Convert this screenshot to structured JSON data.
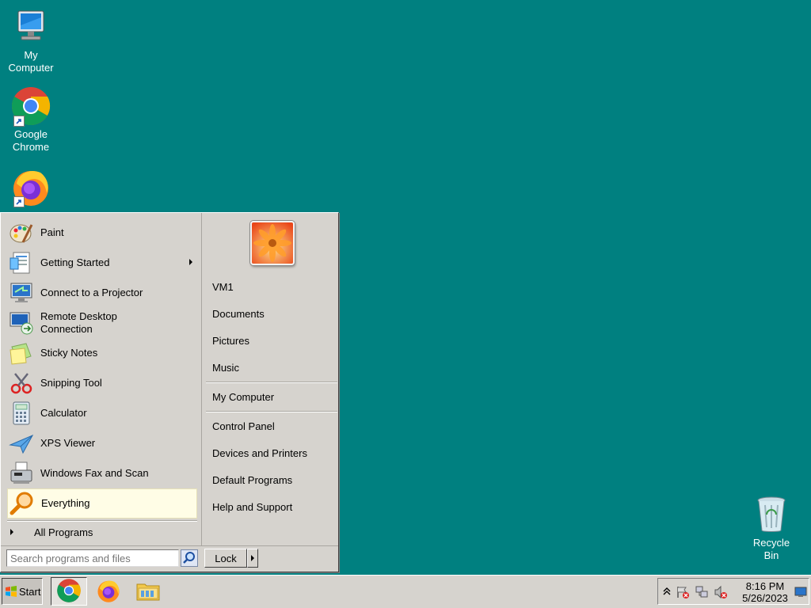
{
  "desktop": {
    "icons": [
      {
        "label": "My Computer",
        "icon": "computer-icon"
      },
      {
        "label": "Google Chrome",
        "icon": "chrome-icon"
      },
      {
        "label": "Firefox",
        "icon": "firefox-icon"
      },
      {
        "label": "Recycle Bin",
        "icon": "recycle-bin-icon"
      }
    ]
  },
  "start_menu": {
    "programs": [
      {
        "label": "Paint",
        "icon": "paint-icon"
      },
      {
        "label": "Getting Started",
        "icon": "getting-started-icon",
        "has_submenu": true
      },
      {
        "label": "Connect to a Projector",
        "icon": "projector-icon"
      },
      {
        "label": "Remote Desktop Connection",
        "icon": "remote-desktop-icon"
      },
      {
        "label": "Sticky Notes",
        "icon": "sticky-notes-icon"
      },
      {
        "label": "Snipping Tool",
        "icon": "snipping-tool-icon"
      },
      {
        "label": "Calculator",
        "icon": "calculator-icon"
      },
      {
        "label": "XPS Viewer",
        "icon": "xps-viewer-icon"
      },
      {
        "label": "Windows Fax and Scan",
        "icon": "fax-scan-icon"
      },
      {
        "label": "Everything",
        "icon": "everything-search-icon",
        "highlighted": true
      }
    ],
    "all_programs": "All Programs",
    "right_items": {
      "user": "VM1",
      "documents": "Documents",
      "pictures": "Pictures",
      "music": "Music",
      "my_computer": "My Computer",
      "control_panel": "Control Panel",
      "devices_printers": "Devices and Printers",
      "default_programs": "Default Programs",
      "help_support": "Help and Support"
    },
    "search_placeholder": "Search programs and files",
    "lock_label": "Lock"
  },
  "taskbar": {
    "start_label": "Start",
    "pinned": [
      "chrome-icon",
      "firefox-icon",
      "explorer-icon"
    ],
    "clock_time": "8:16 PM",
    "clock_date": "5/26/2023"
  },
  "colors": {
    "desktop": "#008080",
    "menu": "#d6d3ce",
    "highlight": "#fffde6"
  }
}
